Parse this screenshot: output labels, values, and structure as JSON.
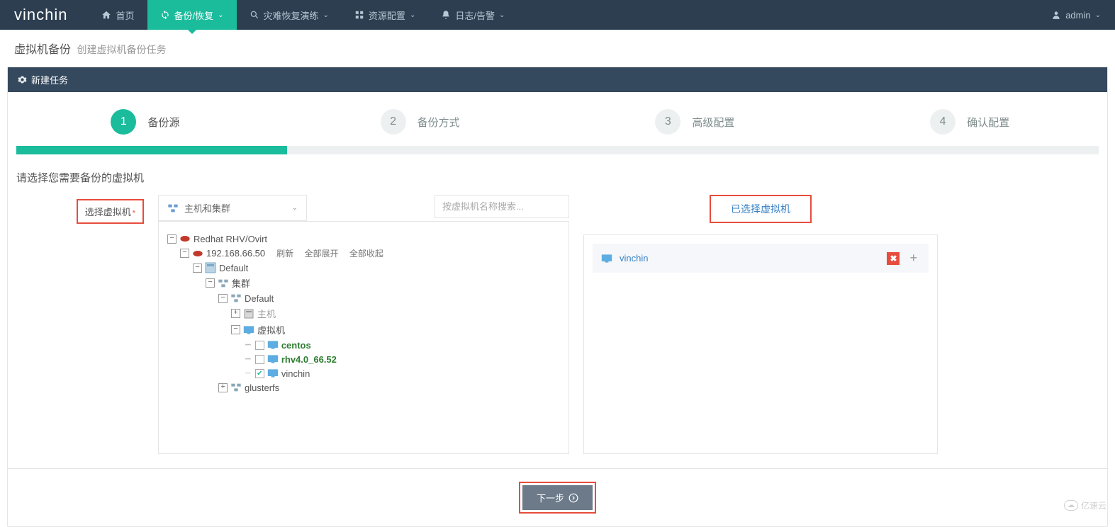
{
  "logo": "vinchin",
  "nav": {
    "home": "首页",
    "backup": "备份/恢复",
    "disaster": "灾难恢复演练",
    "resource": "资源配置",
    "log": "日志/告警"
  },
  "user": {
    "name": "admin"
  },
  "breadcrumb": {
    "main": "虚拟机备份",
    "sub": "创建虚拟机备份任务"
  },
  "panel": {
    "title": "新建任务"
  },
  "steps": [
    {
      "num": "1",
      "label": "备份源"
    },
    {
      "num": "2",
      "label": "备份方式"
    },
    {
      "num": "3",
      "label": "高级配置"
    },
    {
      "num": "4",
      "label": "确认配置"
    }
  ],
  "section": {
    "title": "请选择您需要备份的虚拟机"
  },
  "form": {
    "select_vm_label": "选择虚拟机",
    "dropdown_label": "主机和集群",
    "search_placeholder": "按虚拟机名称搜索...",
    "selected_title": "已选择虚拟机"
  },
  "tree": {
    "root": "Redhat RHV/Ovirt",
    "host": "192.168.66.50",
    "actions": {
      "refresh": "刷新",
      "expand": "全部展开",
      "collapse": "全部收起"
    },
    "dc": "Default",
    "cluster_label": "集群",
    "cluster_default": "Default",
    "hosts_label": "主机",
    "vms_label": "虚拟机",
    "vms": [
      "centos",
      "rhv4.0_66.52",
      "vinchin"
    ],
    "glusterfs": "glusterfs"
  },
  "selected": {
    "items": [
      "vinchin"
    ]
  },
  "buttons": {
    "next": "下一步"
  },
  "watermark": "亿速云"
}
